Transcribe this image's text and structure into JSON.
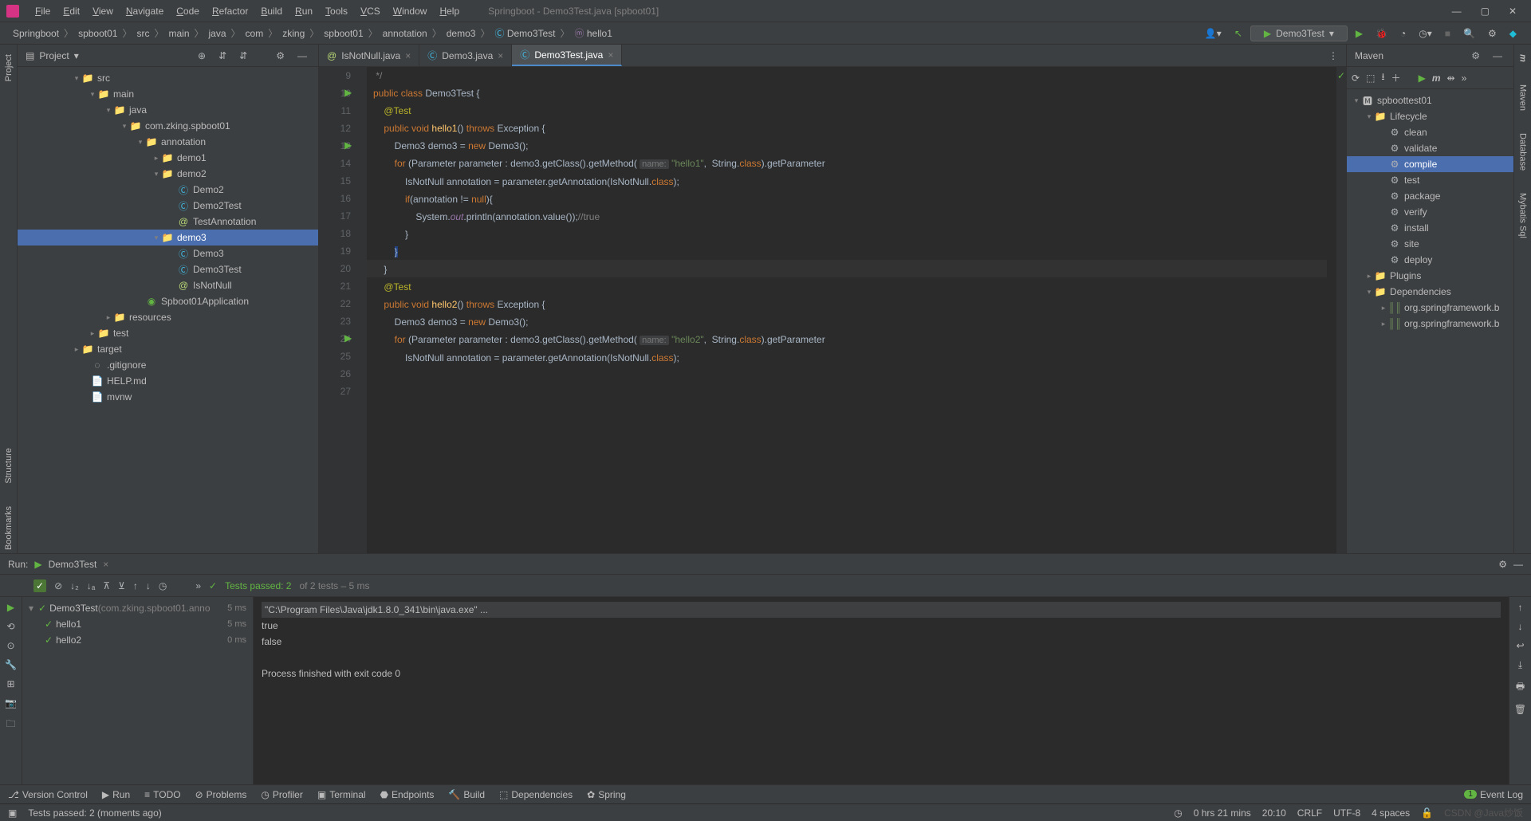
{
  "window": {
    "title": "Springboot - Demo3Test.java [spboot01]"
  },
  "menu": [
    "File",
    "Edit",
    "View",
    "Navigate",
    "Code",
    "Refactor",
    "Build",
    "Run",
    "Tools",
    "VCS",
    "Window",
    "Help"
  ],
  "breadcrumbs": [
    "Springboot",
    "spboot01",
    "src",
    "main",
    "java",
    "com",
    "zking",
    "spboot01",
    "annotation",
    "demo3",
    "Demo3Test",
    "hello1"
  ],
  "runConfig": {
    "label": "Demo3Test"
  },
  "projectPanel": {
    "title": "Project"
  },
  "projectTree": [
    {
      "indent": 68,
      "arrow": "▾",
      "iconClass": "folder-icon",
      "icon": "📁",
      "label": "src"
    },
    {
      "indent": 88,
      "arrow": "▾",
      "iconClass": "folder-icon",
      "icon": "📁",
      "label": "main"
    },
    {
      "indent": 108,
      "arrow": "▾",
      "iconClass": "folder-icon",
      "icon": "📁",
      "label": "java"
    },
    {
      "indent": 128,
      "arrow": "▾",
      "iconClass": "folder-icon",
      "icon": "📁",
      "label": "com.zking.spboot01"
    },
    {
      "indent": 148,
      "arrow": "▾",
      "iconClass": "folder-icon",
      "icon": "📁",
      "label": "annotation"
    },
    {
      "indent": 168,
      "arrow": "▸",
      "iconClass": "folder-icon",
      "icon": "📁",
      "label": "demo1"
    },
    {
      "indent": 168,
      "arrow": "▾",
      "iconClass": "folder-icon",
      "icon": "📁",
      "label": "demo2"
    },
    {
      "indent": 188,
      "arrow": "",
      "iconClass": "class-icon",
      "icon": "Ⓒ",
      "label": "Demo2"
    },
    {
      "indent": 188,
      "arrow": "",
      "iconClass": "class-icon",
      "icon": "Ⓒ",
      "label": "Demo2Test"
    },
    {
      "indent": 188,
      "arrow": "",
      "iconClass": "anno-icon",
      "icon": "@",
      "label": "TestAnnotation"
    },
    {
      "indent": 168,
      "arrow": "▾",
      "iconClass": "folder-icon",
      "icon": "📁",
      "label": "demo3",
      "selected": true
    },
    {
      "indent": 188,
      "arrow": "",
      "iconClass": "class-icon",
      "icon": "Ⓒ",
      "label": "Demo3"
    },
    {
      "indent": 188,
      "arrow": "",
      "iconClass": "class-icon",
      "icon": "Ⓒ",
      "label": "Demo3Test"
    },
    {
      "indent": 188,
      "arrow": "",
      "iconClass": "anno-icon",
      "icon": "@",
      "label": "IsNotNull"
    },
    {
      "indent": 148,
      "arrow": "",
      "iconClass": "spring-icon",
      "icon": "◉",
      "label": "Spboot01Application"
    },
    {
      "indent": 108,
      "arrow": "▸",
      "iconClass": "folder-icon",
      "icon": "📁",
      "label": "resources"
    },
    {
      "indent": 88,
      "arrow": "▸",
      "iconClass": "folder-icon",
      "icon": "📁",
      "label": "test"
    },
    {
      "indent": 68,
      "arrow": "▸",
      "iconClass": "folder-icon orange",
      "icon": "📁",
      "label": "target"
    },
    {
      "indent": 80,
      "arrow": "",
      "iconClass": "",
      "icon": "◌",
      "label": ".gitignore"
    },
    {
      "indent": 80,
      "arrow": "",
      "iconClass": "",
      "icon": "📄",
      "label": "HELP.md"
    },
    {
      "indent": 80,
      "arrow": "",
      "iconClass": "",
      "icon": "📄",
      "label": "mvnw"
    }
  ],
  "tabs": [
    {
      "label": "IsNotNull.java",
      "active": false,
      "icon": "@",
      "iconClass": "anno-icon"
    },
    {
      "label": "Demo3.java",
      "active": false,
      "icon": "Ⓒ",
      "iconClass": "class-icon"
    },
    {
      "label": "Demo3Test.java",
      "active": true,
      "icon": "Ⓒ",
      "iconClass": "class-icon"
    }
  ],
  "code": {
    "firstLine": 9,
    "caretLine": 20,
    "checkmark": "✓",
    "lines": [
      " <span class='com'>*/</span>",
      "<span class='kw'>public</span> <span class='kw'>class</span> Demo3Test {",
      "",
      "    <span class='ann'>@Test</span>",
      "    <span class='kw'>public</span> <span class='kw'>void</span> <span class='fn'>hello1</span>() <span class='kw'>throws</span> Exception {",
      "        Demo3 demo3 = <span class='kw'>new</span> Demo3();",
      "        <span class='kw'>for</span> (Parameter parameter : demo3.getClass().getMethod( <span class='hint'>name:</span> <span class='str'>\"hello1\"</span>,  String.<span class='kw'>class</span>).getParameter",
      "            IsNotNull annotation = parameter.getAnnotation(IsNotNull.<span class='kw'>class</span>);",
      "            <span class='kw'>if</span>(annotation != <span class='kw'>null</span>){",
      "                System.<span class='fld'>out</span>.println(annotation.value());<span class='com'>//true</span>",
      "            }",
      "        <span style='background:#214283;'>}</span>",
      "    }",
      "",
      "    <span class='ann'>@Test</span>",
      "    <span class='kw'>public</span> <span class='kw'>void</span> <span class='fn'>hello2</span>() <span class='kw'>throws</span> Exception {",
      "        Demo3 demo3 = <span class='kw'>new</span> Demo3();",
      "        <span class='kw'>for</span> (Parameter parameter : demo3.getClass().getMethod( <span class='hint'>name:</span> <span class='str'>\"hello2\"</span>,  String.<span class='kw'>class</span>).getParameter",
      "            IsNotNull annotation = parameter.getAnnotation(IsNotNull.<span class='kw'>class</span>);"
    ],
    "gutterIcons": [
      {
        "line": 10,
        "glyph": "▶",
        "color": "#62b543"
      },
      {
        "line": 13,
        "glyph": "▶",
        "color": "#62b543"
      },
      {
        "line": 24,
        "glyph": "▶",
        "color": "#62b543"
      }
    ]
  },
  "mavenPanel": {
    "title": "Maven"
  },
  "mavenTree": [
    {
      "indent": 6,
      "arrow": "▾",
      "iconClass": "",
      "icon": "🅼",
      "label": "spboottest01"
    },
    {
      "indent": 22,
      "arrow": "▾",
      "iconClass": "folder-icon",
      "icon": "📁",
      "label": "Lifecycle"
    },
    {
      "indent": 40,
      "arrow": "",
      "iconClass": "gear-icon",
      "icon": "⚙",
      "label": "clean"
    },
    {
      "indent": 40,
      "arrow": "",
      "iconClass": "gear-icon",
      "icon": "⚙",
      "label": "validate"
    },
    {
      "indent": 40,
      "arrow": "",
      "iconClass": "gear-icon",
      "icon": "⚙",
      "label": "compile",
      "selected": true
    },
    {
      "indent": 40,
      "arrow": "",
      "iconClass": "gear-icon",
      "icon": "⚙",
      "label": "test"
    },
    {
      "indent": 40,
      "arrow": "",
      "iconClass": "gear-icon",
      "icon": "⚙",
      "label": "package"
    },
    {
      "indent": 40,
      "arrow": "",
      "iconClass": "gear-icon",
      "icon": "⚙",
      "label": "verify"
    },
    {
      "indent": 40,
      "arrow": "",
      "iconClass": "gear-icon",
      "icon": "⚙",
      "label": "install"
    },
    {
      "indent": 40,
      "arrow": "",
      "iconClass": "gear-icon",
      "icon": "⚙",
      "label": "site"
    },
    {
      "indent": 40,
      "arrow": "",
      "iconClass": "gear-icon",
      "icon": "⚙",
      "label": "deploy"
    },
    {
      "indent": 22,
      "arrow": "▸",
      "iconClass": "folder-icon",
      "icon": "📁",
      "label": "Plugins"
    },
    {
      "indent": 22,
      "arrow": "▾",
      "iconClass": "folder-icon",
      "icon": "📁",
      "label": "Dependencies"
    },
    {
      "indent": 40,
      "arrow": "▸",
      "iconClass": "lib-icon",
      "icon": "║║",
      "label": "org.springframework.b"
    },
    {
      "indent": 40,
      "arrow": "▸",
      "iconClass": "lib-icon",
      "icon": "║║",
      "label": "org.springframework.b"
    }
  ],
  "runPanel": {
    "label": "Run:",
    "configName": "Demo3Test",
    "testsStatus": "Tests passed: 2",
    "testsTotal": " of 2 tests – 5 ms",
    "tree": [
      {
        "indent": 8,
        "arrow": "▾",
        "check": "✓",
        "label": "Demo3Test",
        "sub": "(com.zking.spboot01.anno",
        "time": "5 ms"
      },
      {
        "indent": 28,
        "arrow": "",
        "check": "✓",
        "label": "hello1",
        "sub": "",
        "time": "5 ms"
      },
      {
        "indent": 28,
        "arrow": "",
        "check": "✓",
        "label": "hello2",
        "sub": "",
        "time": "0 ms"
      }
    ],
    "console": [
      {
        "cls": "cmd-bg",
        "text": "\"C:\\Program Files\\Java\\jdk1.8.0_341\\bin\\java.exe\" ..."
      },
      {
        "cls": "",
        "text": "true"
      },
      {
        "cls": "",
        "text": "false"
      },
      {
        "cls": "",
        "text": ""
      },
      {
        "cls": "",
        "text": "Process finished with exit code 0"
      }
    ]
  },
  "bottomBar": {
    "items": [
      {
        "icon": "⎇",
        "label": "Version Control"
      },
      {
        "icon": "▶",
        "label": "Run"
      },
      {
        "icon": "≡",
        "label": "TODO"
      },
      {
        "icon": "⊘",
        "label": "Problems"
      },
      {
        "icon": "◷",
        "label": "Profiler"
      },
      {
        "icon": "▣",
        "label": "Terminal"
      },
      {
        "icon": "⬣",
        "label": "Endpoints"
      },
      {
        "icon": "🔨",
        "label": "Build"
      },
      {
        "icon": "⬚",
        "label": "Dependencies"
      },
      {
        "icon": "✿",
        "label": "Spring"
      }
    ],
    "eventLog": "Event Log"
  },
  "statusBar": {
    "message": "Tests passed: 2 (moments ago)",
    "time": "0 hrs 21 mins",
    "pos": "20:10",
    "eol": "CRLF",
    "enc": "UTF-8",
    "indent": "4 spaces",
    "watermark": "CSDN @Java炒饭"
  },
  "leftGutter": [
    "Project"
  ],
  "leftGutterBottom": [
    "Structure",
    "Bookmarks"
  ],
  "rightGutter": [
    "Maven",
    "Database",
    "Mybatis Sql"
  ]
}
